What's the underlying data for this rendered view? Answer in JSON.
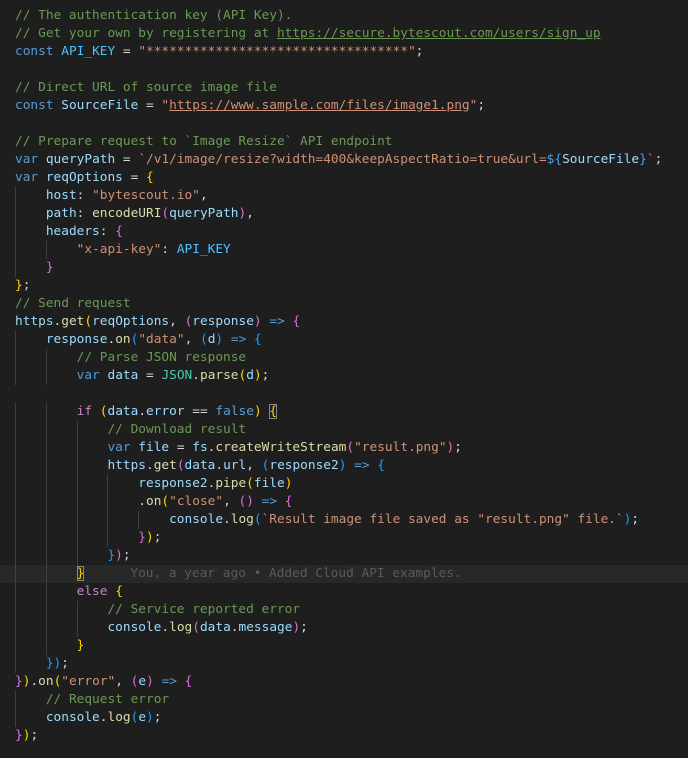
{
  "editor": {
    "language": "JavaScript",
    "lines": [
      [
        [
          "c",
          "// The authentication key (API Key).",
          null
        ]
      ],
      [
        [
          "c",
          "// Get your own by registering at ",
          null
        ],
        [
          "c",
          "https://secure.bytescout.com/users/sign_up",
          "url"
        ]
      ],
      [
        [
          "k",
          "const",
          null
        ],
        [
          "p",
          " ",
          null
        ],
        [
          "n",
          "API_KEY",
          null
        ],
        [
          "p",
          " = ",
          null
        ],
        [
          "s",
          "\"**********************************\"",
          null
        ],
        [
          "p",
          ";",
          null
        ]
      ],
      [],
      [
        [
          "c",
          "// Direct URL of source image file",
          null
        ]
      ],
      [
        [
          "k",
          "const",
          null
        ],
        [
          "p",
          " ",
          null
        ],
        [
          "v",
          "SourceFile",
          null
        ],
        [
          "p",
          " = ",
          null
        ],
        [
          "s",
          "\"",
          null
        ],
        [
          "s",
          "https://www.sample.com/files/image1.png",
          "url"
        ],
        [
          "s",
          "\"",
          null
        ],
        [
          "p",
          ";",
          null
        ]
      ],
      [],
      [
        [
          "c",
          "// Prepare request to `Image Resize` API endpoint",
          null
        ]
      ],
      [
        [
          "k",
          "var",
          null
        ],
        [
          "p",
          " ",
          null
        ],
        [
          "v",
          "queryPath",
          null
        ],
        [
          "p",
          " = ",
          null
        ],
        [
          "s",
          "`/v1/image/resize?width=400&keepAspectRatio=true&url=",
          null
        ],
        [
          "k",
          "${",
          null
        ],
        [
          "v",
          "SourceFile",
          null
        ],
        [
          "k",
          "}",
          null
        ],
        [
          "s",
          "`",
          null
        ],
        [
          "p",
          ";",
          null
        ]
      ],
      [
        [
          "k",
          "var",
          null
        ],
        [
          "p",
          " ",
          null
        ],
        [
          "v",
          "reqOptions",
          null
        ],
        [
          "p",
          " = ",
          null
        ],
        [
          "b1",
          "{",
          null
        ]
      ],
      [
        [
          "p",
          "    ",
          null
        ],
        [
          "v",
          "host",
          null
        ],
        [
          "p",
          ": ",
          null
        ],
        [
          "s",
          "\"bytescout.io\"",
          null
        ],
        [
          "p",
          ",",
          null
        ]
      ],
      [
        [
          "p",
          "    ",
          null
        ],
        [
          "v",
          "path",
          null
        ],
        [
          "p",
          ": ",
          null
        ],
        [
          "f",
          "encodeURI",
          null
        ],
        [
          "b2",
          "(",
          null
        ],
        [
          "v",
          "queryPath",
          null
        ],
        [
          "b2",
          ")",
          null
        ],
        [
          "p",
          ",",
          null
        ]
      ],
      [
        [
          "p",
          "    ",
          null
        ],
        [
          "v",
          "headers",
          null
        ],
        [
          "p",
          ": ",
          null
        ],
        [
          "b2",
          "{",
          null
        ]
      ],
      [
        [
          "p",
          "        ",
          null
        ],
        [
          "s",
          "\"x-api-key\"",
          null
        ],
        [
          "p",
          ": ",
          null
        ],
        [
          "n",
          "API_KEY",
          null
        ]
      ],
      [
        [
          "p",
          "    ",
          null
        ],
        [
          "b2",
          "}",
          null
        ]
      ],
      [
        [
          "b1",
          "}",
          null
        ],
        [
          "p",
          ";",
          null
        ]
      ],
      [
        [
          "c",
          "// Send request",
          null
        ]
      ],
      [
        [
          "v",
          "https",
          null
        ],
        [
          "p",
          ".",
          null
        ],
        [
          "f",
          "get",
          null
        ],
        [
          "b1",
          "(",
          null
        ],
        [
          "v",
          "reqOptions",
          null
        ],
        [
          "p",
          ", ",
          null
        ],
        [
          "b2",
          "(",
          null
        ],
        [
          "v",
          "response",
          null
        ],
        [
          "b2",
          ")",
          null
        ],
        [
          "p",
          " ",
          null
        ],
        [
          "k",
          "=>",
          null
        ],
        [
          "p",
          " ",
          null
        ],
        [
          "b2",
          "{",
          null
        ]
      ],
      [
        [
          "p",
          "    ",
          null
        ],
        [
          "v",
          "response",
          null
        ],
        [
          "p",
          ".",
          null
        ],
        [
          "f",
          "on",
          null
        ],
        [
          "b3",
          "(",
          null
        ],
        [
          "s",
          "\"data\"",
          null
        ],
        [
          "p",
          ", ",
          null
        ],
        [
          "b3",
          "(",
          null
        ],
        [
          "v",
          "d",
          null
        ],
        [
          "b3",
          ")",
          null
        ],
        [
          "p",
          " ",
          null
        ],
        [
          "k",
          "=>",
          null
        ],
        [
          "p",
          " ",
          null
        ],
        [
          "b3",
          "{",
          null
        ]
      ],
      [
        [
          "p",
          "        ",
          null
        ],
        [
          "c",
          "// Parse JSON response",
          null
        ]
      ],
      [
        [
          "p",
          "        ",
          null
        ],
        [
          "k",
          "var",
          null
        ],
        [
          "p",
          " ",
          null
        ],
        [
          "v",
          "data",
          null
        ],
        [
          "p",
          " = ",
          null
        ],
        [
          "t",
          "JSON",
          null
        ],
        [
          "p",
          ".",
          null
        ],
        [
          "f",
          "parse",
          null
        ],
        [
          "b1",
          "(",
          null
        ],
        [
          "v",
          "d",
          null
        ],
        [
          "b1",
          ")",
          null
        ],
        [
          "p",
          ";",
          null
        ]
      ],
      [],
      [
        [
          "p",
          "        ",
          null
        ],
        [
          "x",
          "if",
          null
        ],
        [
          "p",
          " ",
          null
        ],
        [
          "b1",
          "(",
          null
        ],
        [
          "v",
          "data",
          null
        ],
        [
          "p",
          ".",
          null
        ],
        [
          "v",
          "error",
          null
        ],
        [
          "p",
          " == ",
          null
        ],
        [
          "k",
          "false",
          null
        ],
        [
          "b1",
          ")",
          null
        ],
        [
          "p",
          " ",
          null
        ],
        [
          "m",
          "{",
          null
        ]
      ],
      [
        [
          "p",
          "            ",
          null
        ],
        [
          "c",
          "// Download result",
          null
        ]
      ],
      [
        [
          "p",
          "            ",
          null
        ],
        [
          "k",
          "var",
          null
        ],
        [
          "p",
          " ",
          null
        ],
        [
          "v",
          "file",
          null
        ],
        [
          "p",
          " = ",
          null
        ],
        [
          "v",
          "fs",
          null
        ],
        [
          "p",
          ".",
          null
        ],
        [
          "f",
          "createWriteStream",
          null
        ],
        [
          "b2",
          "(",
          null
        ],
        [
          "s",
          "\"result.png\"",
          null
        ],
        [
          "b2",
          ")",
          null
        ],
        [
          "p",
          ";",
          null
        ]
      ],
      [
        [
          "p",
          "            ",
          null
        ],
        [
          "v",
          "https",
          null
        ],
        [
          "p",
          ".",
          null
        ],
        [
          "f",
          "get",
          null
        ],
        [
          "b2",
          "(",
          null
        ],
        [
          "v",
          "data",
          null
        ],
        [
          "p",
          ".",
          null
        ],
        [
          "v",
          "url",
          null
        ],
        [
          "p",
          ", ",
          null
        ],
        [
          "b3",
          "(",
          null
        ],
        [
          "v",
          "response2",
          null
        ],
        [
          "b3",
          ")",
          null
        ],
        [
          "p",
          " ",
          null
        ],
        [
          "k",
          "=>",
          null
        ],
        [
          "p",
          " ",
          null
        ],
        [
          "b3",
          "{",
          null
        ]
      ],
      [
        [
          "p",
          "                ",
          null
        ],
        [
          "v",
          "response2",
          null
        ],
        [
          "p",
          ".",
          null
        ],
        [
          "f",
          "pipe",
          null
        ],
        [
          "b1",
          "(",
          null
        ],
        [
          "v",
          "file",
          null
        ],
        [
          "b1",
          ")",
          null
        ]
      ],
      [
        [
          "p",
          "                ",
          null
        ],
        [
          "p",
          ".",
          null
        ],
        [
          "f",
          "on",
          null
        ],
        [
          "b1",
          "(",
          null
        ],
        [
          "s",
          "\"close\"",
          null
        ],
        [
          "p",
          ", ",
          null
        ],
        [
          "b2",
          "()",
          null
        ],
        [
          "p",
          " ",
          null
        ],
        [
          "k",
          "=>",
          null
        ],
        [
          "p",
          " ",
          null
        ],
        [
          "b2",
          "{",
          null
        ]
      ],
      [
        [
          "p",
          "                    ",
          null
        ],
        [
          "v",
          "console",
          null
        ],
        [
          "p",
          ".",
          null
        ],
        [
          "f",
          "log",
          null
        ],
        [
          "b3",
          "(",
          null
        ],
        [
          "s",
          "`Result image file saved as \"result.png\" file.`",
          null
        ],
        [
          "b3",
          ")",
          null
        ],
        [
          "p",
          ";",
          null
        ]
      ],
      [
        [
          "p",
          "                ",
          null
        ],
        [
          "b2",
          "}",
          null
        ],
        [
          "b1",
          ")",
          null
        ],
        [
          "p",
          ";",
          null
        ]
      ],
      [
        [
          "p",
          "            ",
          null
        ],
        [
          "b3",
          "}",
          null
        ],
        [
          "b2",
          ")",
          null
        ],
        [
          "p",
          ";",
          null
        ]
      ],
      [
        [
          "p",
          "        ",
          null
        ],
        [
          "m",
          "}",
          null
        ]
      ],
      [
        [
          "p",
          "        ",
          null
        ],
        [
          "x",
          "else",
          null
        ],
        [
          "p",
          " ",
          null
        ],
        [
          "b1",
          "{",
          null
        ]
      ],
      [
        [
          "p",
          "            ",
          null
        ],
        [
          "c",
          "// Service reported error",
          null
        ]
      ],
      [
        [
          "p",
          "            ",
          null
        ],
        [
          "v",
          "console",
          null
        ],
        [
          "p",
          ".",
          null
        ],
        [
          "f",
          "log",
          null
        ],
        [
          "b2",
          "(",
          null
        ],
        [
          "v",
          "data",
          null
        ],
        [
          "p",
          ".",
          null
        ],
        [
          "v",
          "message",
          null
        ],
        [
          "b2",
          ")",
          null
        ],
        [
          "p",
          ";",
          null
        ]
      ],
      [
        [
          "p",
          "        ",
          null
        ],
        [
          "b1",
          "}",
          null
        ]
      ],
      [
        [
          "p",
          "    ",
          null
        ],
        [
          "b3",
          "}",
          null
        ],
        [
          "b3",
          ")",
          null
        ],
        [
          "p",
          ";",
          null
        ]
      ],
      [
        [
          "b2",
          "}",
          null
        ],
        [
          "b1",
          ")",
          null
        ],
        [
          "p",
          ".",
          null
        ],
        [
          "f",
          "on",
          null
        ],
        [
          "b1",
          "(",
          null
        ],
        [
          "s",
          "\"error\"",
          null
        ],
        [
          "p",
          ", ",
          null
        ],
        [
          "b2",
          "(",
          null
        ],
        [
          "v",
          "e",
          null
        ],
        [
          "b2",
          ")",
          null
        ],
        [
          "p",
          " ",
          null
        ],
        [
          "k",
          "=>",
          null
        ],
        [
          "p",
          " ",
          null
        ],
        [
          "b2",
          "{",
          null
        ]
      ],
      [
        [
          "p",
          "    ",
          null
        ],
        [
          "c",
          "// Request error",
          null
        ]
      ],
      [
        [
          "p",
          "    ",
          null
        ],
        [
          "v",
          "console",
          null
        ],
        [
          "p",
          ".",
          null
        ],
        [
          "f",
          "log",
          null
        ],
        [
          "b3",
          "(",
          null
        ],
        [
          "v",
          "e",
          null
        ],
        [
          "b3",
          ")",
          null
        ],
        [
          "p",
          ";",
          null
        ]
      ],
      [
        [
          "b2",
          "}",
          null
        ],
        [
          "b1",
          ")",
          null
        ],
        [
          "p",
          ";",
          null
        ]
      ]
    ],
    "current_line": 31,
    "blame": {
      "line": 31,
      "text": "You, a year ago • Added Cloud API examples."
    },
    "colors": {
      "background": "#1e1e1e",
      "current_line": "#282828",
      "indent_guide": "#404040",
      "comment": "#6a9955",
      "keyword": "#569cd6",
      "control": "#c586c0",
      "string": "#ce9178",
      "variable": "#9cdcfe",
      "constant": "#4fc1ff",
      "function": "#dcdcaa",
      "type": "#4ec9b0",
      "bracket_1": "#ffd700",
      "bracket_2": "#da70d6",
      "bracket_3": "#179fff"
    }
  }
}
